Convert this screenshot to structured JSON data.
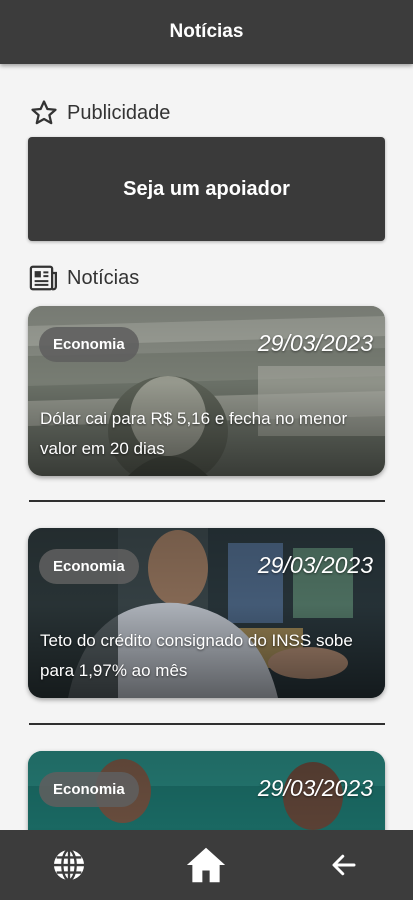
{
  "appbar": {
    "title": "Notícias"
  },
  "ads_section": {
    "title": "Publicidade",
    "icon": "star-outline-icon"
  },
  "support_banner": {
    "label": "Seja um apoiador"
  },
  "news_section": {
    "title": "Notícias",
    "icon": "newspaper-icon"
  },
  "news": [
    {
      "category": "Economia",
      "date": "29/03/2023",
      "headline": "Dólar cai para R$ 5,16 e fecha no menor valor em 20 dias"
    },
    {
      "category": "Economia",
      "date": "29/03/2023",
      "headline": "Teto do crédito consignado do INSS sobe para 1,97% ao mês"
    },
    {
      "category": "Economia",
      "date": "29/03/2023",
      "headline": ""
    }
  ],
  "bottom_nav": {
    "items": [
      {
        "name": "globe",
        "icon": "globe-icon"
      },
      {
        "name": "home",
        "icon": "home-icon"
      },
      {
        "name": "back",
        "icon": "arrow-left-icon"
      }
    ]
  },
  "colors": {
    "bar": "#3c3c3c",
    "background": "#f4f4f4",
    "banner": "#3a3a3a"
  }
}
